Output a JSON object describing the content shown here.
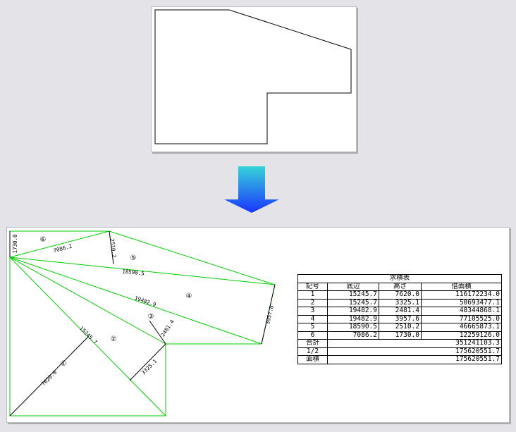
{
  "colors": {
    "background": "#e4e4e8",
    "panel": "#ffffff",
    "outline": "#000000",
    "triangles": "#00cc00",
    "arrow_top": "#37d3d9",
    "arrow_bottom": "#1a33ff"
  },
  "triangle_labels": {
    "t1": "①",
    "t2": "②",
    "t3": "③",
    "t4": "④",
    "t5": "⑤",
    "t6": "⑥"
  },
  "edge_labels": {
    "e_15245": "15245.7",
    "e_7620": "7620.0",
    "e_3325": "3325.1",
    "e_2481": "2481.4",
    "e_19482": "19482.9",
    "e_3957": "3957.6",
    "e_18590": "18590.5",
    "e_2510": "2510.2",
    "e_7086": "7086.2",
    "e_1730": "1730.0"
  },
  "table": {
    "title": "求積表",
    "headers": [
      "記号",
      "底辺",
      "高さ",
      "倍面積"
    ],
    "rows": [
      [
        "1",
        "15245.7",
        "7620.0",
        "116172234.0"
      ],
      [
        "2",
        "15245.7",
        "3325.1",
        "50693477.1"
      ],
      [
        "3",
        "19482.9",
        "2481.4",
        "48344868.1"
      ],
      [
        "4",
        "19482.9",
        "3957.6",
        "77105525.0"
      ],
      [
        "5",
        "18590.5",
        "2510.2",
        "46665873.1"
      ],
      [
        "6",
        "7086.2",
        "1730.0",
        "12259126.0"
      ]
    ],
    "total_label": "合計",
    "total_value": "351241103.3",
    "half_label": "1/2",
    "half_value": "175620551.7",
    "area_label": "面積",
    "area_value": "175620551.7"
  }
}
